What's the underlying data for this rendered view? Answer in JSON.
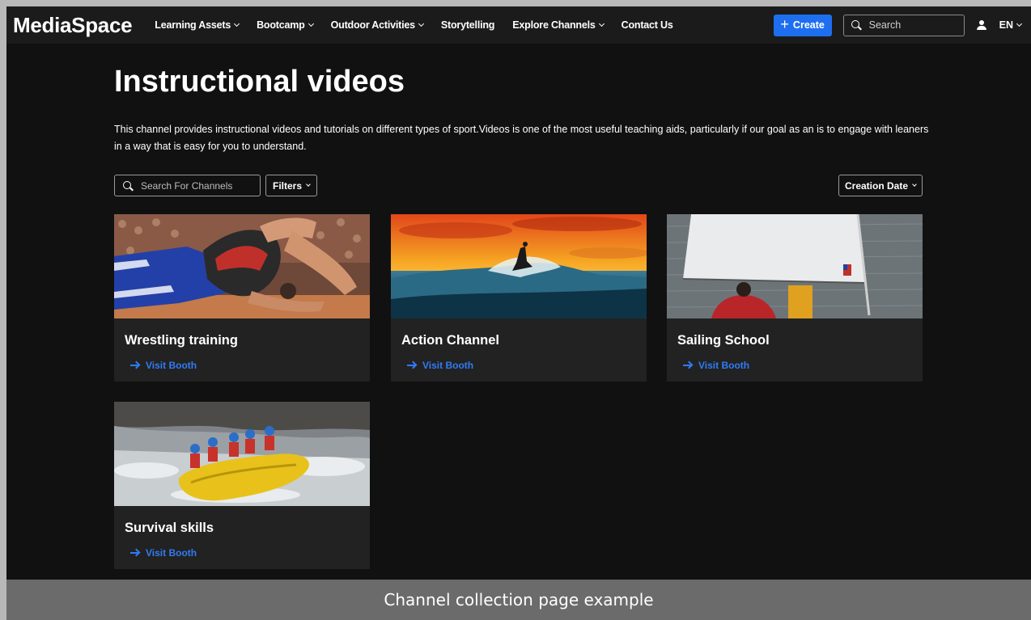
{
  "header": {
    "logo": "MediaSpace",
    "nav": [
      {
        "label": "Learning Assets",
        "dropdown": true
      },
      {
        "label": "Bootcamp",
        "dropdown": true
      },
      {
        "label": "Outdoor Activities",
        "dropdown": true
      },
      {
        "label": "Storytelling",
        "dropdown": false
      },
      {
        "label": "Explore Channels",
        "dropdown": true
      },
      {
        "label": "Contact Us",
        "dropdown": false
      }
    ],
    "create_label": "Create",
    "search_placeholder": "Search",
    "language": "EN"
  },
  "page": {
    "title": "Instructional videos",
    "description": "This channel provides instructional videos and tutorials on different types of sport.Videos is one of the most useful teaching aids, particularly if our goal as an is to engage with leaners in a way that is easy for you to understand.",
    "channel_search_placeholder": "Search For Channels",
    "filters_label": "Filters",
    "sort_label": "Creation Date"
  },
  "channels": [
    {
      "title": "Wrestling training",
      "link": "Visit Booth",
      "image": "wrestling"
    },
    {
      "title": "Action Channel",
      "link": "Visit Booth",
      "image": "surfing"
    },
    {
      "title": "Sailing School",
      "link": "Visit Booth",
      "image": "sailing"
    },
    {
      "title": "Survival skills",
      "link": "Visit Booth",
      "image": "rafting"
    }
  ],
  "caption": "Channel collection page example",
  "colors": {
    "accent": "#1e6ff0",
    "link": "#2f7cf6",
    "background": "#111111",
    "card": "#222222"
  }
}
